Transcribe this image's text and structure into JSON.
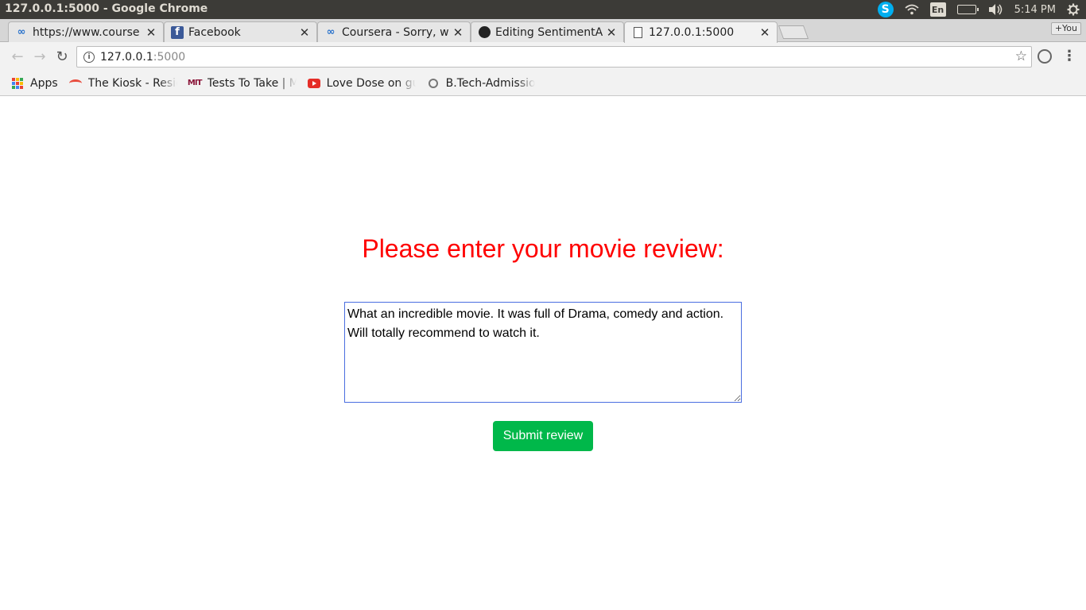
{
  "os": {
    "window_title": "127.0.0.1:5000 - Google Chrome",
    "lang": "En",
    "clock": "5:14 PM"
  },
  "tabs": [
    {
      "title": "https://www.course",
      "icon": "coursera-icon"
    },
    {
      "title": "Facebook",
      "icon": "facebook-icon"
    },
    {
      "title": "Coursera - Sorry, we",
      "icon": "coursera-icon"
    },
    {
      "title": "Editing SentimentA",
      "icon": "github-icon"
    },
    {
      "title": "127.0.0.1:5000",
      "icon": "document-icon"
    }
  ],
  "profile_button": "+You",
  "omnibox": {
    "host": "127.0.0.1",
    "port": ":5000"
  },
  "bookmarks": [
    {
      "label": "Apps"
    },
    {
      "label": "The Kiosk - Resid"
    },
    {
      "label": "Tests To Take | M"
    },
    {
      "label": "Love Dose on gu"
    },
    {
      "label": "B.Tech-Admissio"
    }
  ],
  "main": {
    "heading": "Please enter your movie review:",
    "review_text": "What an incredible movie. It was full of Drama, comedy and action. Will totally recommend to watch it.",
    "submit_label": "Submit review"
  },
  "colors": {
    "heading": "#ff0000",
    "submit_bg": "#00b84a",
    "textarea_border": "#4a6ee0"
  }
}
